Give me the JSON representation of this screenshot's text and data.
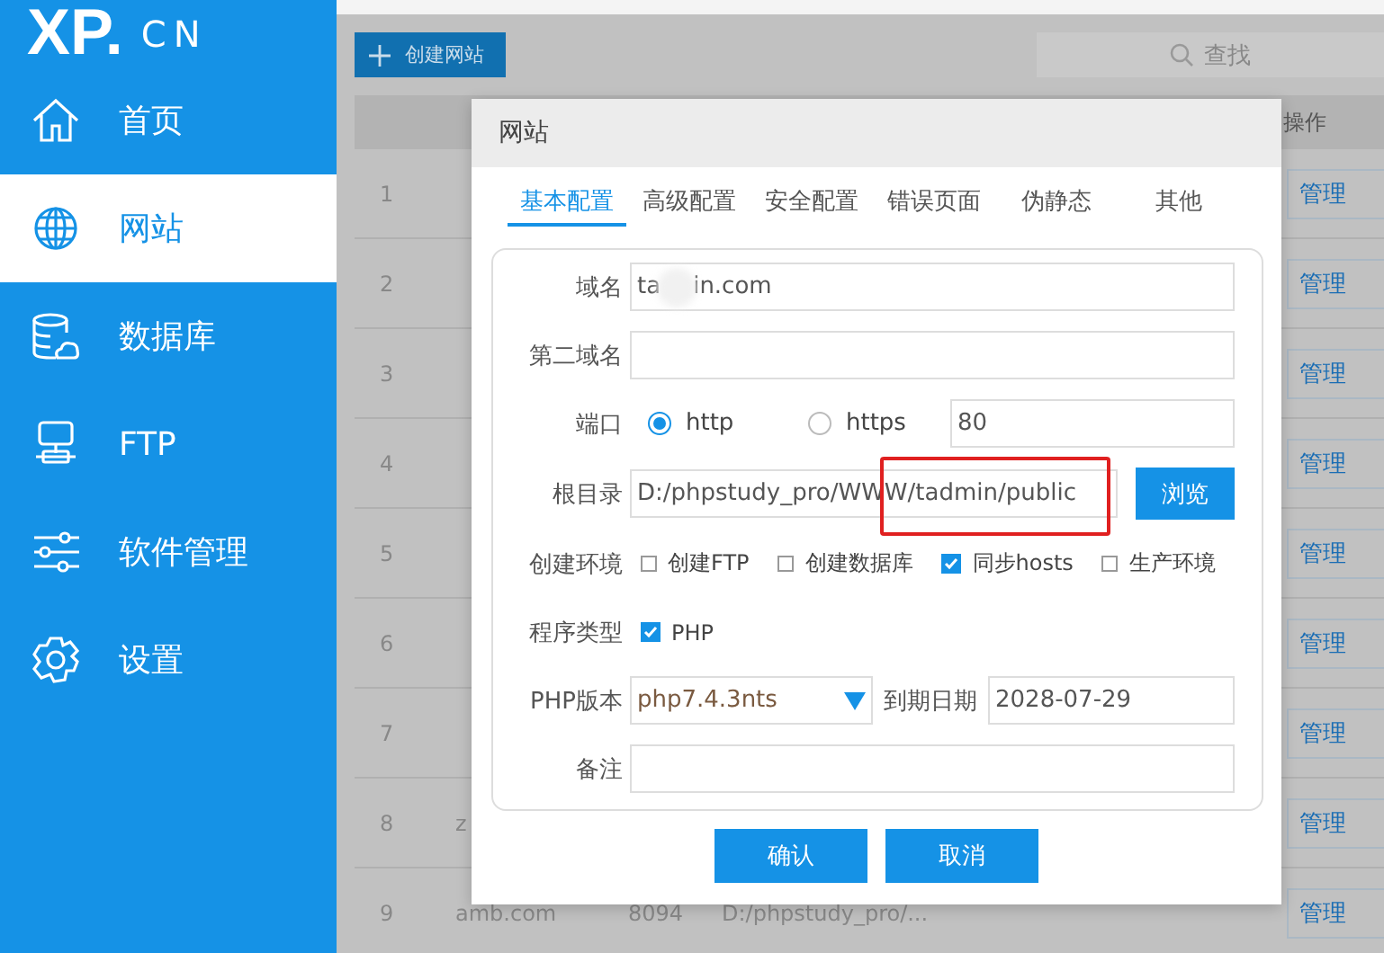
{
  "logo": {
    "mark": "XP.",
    "suffix": "CN"
  },
  "sidebar": {
    "items": [
      {
        "label": "首页",
        "kind": "home",
        "selected": false
      },
      {
        "label": "网站",
        "kind": "globe",
        "selected": true
      },
      {
        "label": "数据库",
        "kind": "database",
        "selected": false
      },
      {
        "label": "FTP",
        "kind": "network",
        "selected": false
      },
      {
        "label": "软件管理",
        "kind": "sliders",
        "selected": false
      },
      {
        "label": "设置",
        "kind": "gear",
        "selected": false
      }
    ]
  },
  "toolbar": {
    "create_button": "创建网站",
    "search": {
      "placeholder": "查找"
    }
  },
  "table": {
    "columns": [
      {
        "label": "操作"
      }
    ],
    "rows": [
      {
        "number": "1",
        "action": "管理"
      },
      {
        "number": "2",
        "action": "管理"
      },
      {
        "number": "3",
        "action": "管理"
      },
      {
        "number": "4",
        "action": "管理"
      },
      {
        "number": "5",
        "action": "管理"
      },
      {
        "number": "6",
        "action": "管理"
      },
      {
        "number": "7",
        "action": "管理"
      },
      {
        "number": "8",
        "column_2": "z",
        "action": "管理"
      },
      {
        "number": "9",
        "column_2": "amb.com",
        "column_3": "8094",
        "column_4": "D:/phpstudy_pro/...",
        "action": "管理"
      }
    ]
  },
  "dialog": {
    "title": "网站",
    "tabs": [
      {
        "label": "基本配置",
        "selected": true
      },
      {
        "label": "高级配置",
        "selected": false
      },
      {
        "label": "安全配置",
        "selected": false
      },
      {
        "label": "错误页面",
        "selected": false
      },
      {
        "label": "伪静态",
        "selected": false
      },
      {
        "label": "其他",
        "selected": false
      }
    ],
    "domain": {
      "label": "域名",
      "value_start": "ta",
      "value_end": "in.com"
    },
    "second_domain": {
      "label": "第二域名"
    },
    "port": {
      "label": "端口",
      "options": [
        {
          "label": "http",
          "selected": true
        },
        {
          "label": "https",
          "selected": false
        }
      ],
      "value": "80"
    },
    "root": {
      "label": "根目录",
      "value": "D:/phpstudy_pro/WWW/tadmin/public",
      "browse": "浏览"
    },
    "environment": {
      "label": "创建环境",
      "options": [
        {
          "label": "创建FTP",
          "checked": false
        },
        {
          "label": "创建数据库",
          "checked": false
        },
        {
          "label": "同步hosts",
          "checked": true
        },
        {
          "label": "生产环境",
          "checked": false
        }
      ]
    },
    "program_type": {
      "label": "程序类型",
      "options": [
        {
          "label": "PHP",
          "checked": true
        }
      ]
    },
    "php_version": {
      "label": "PHP版本",
      "value": "php7.4.3nts"
    },
    "expiry": {
      "label": "到期日期",
      "value": "2028-07-29"
    },
    "note": {
      "label": "备注"
    },
    "buttons": [
      "确认",
      "取消"
    ]
  }
}
